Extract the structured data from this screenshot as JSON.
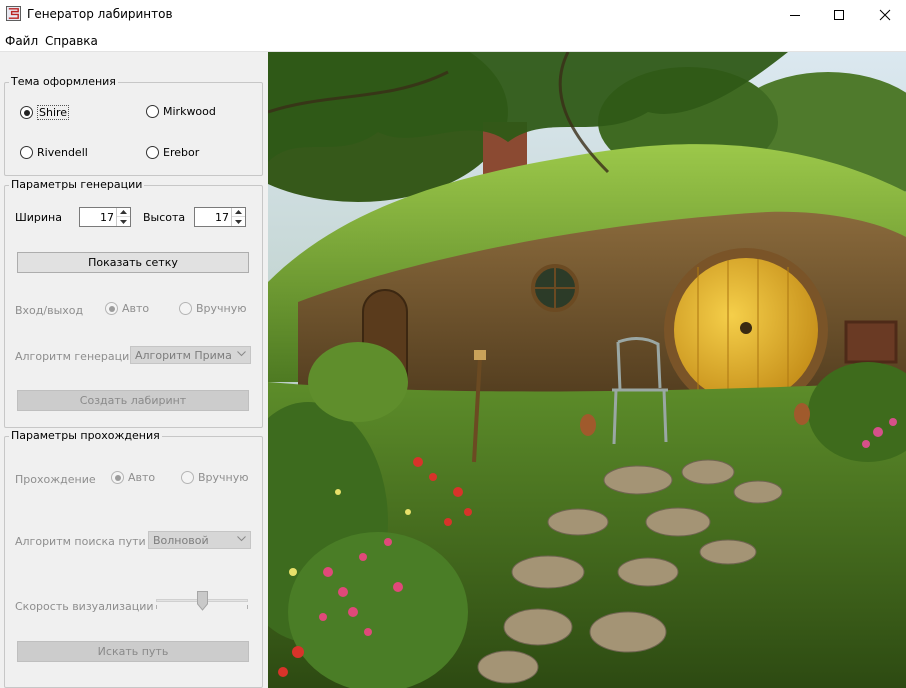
{
  "window": {
    "title": "Генератор лабиринтов",
    "icon": "maze-app-icon"
  },
  "menu": {
    "items": [
      "Файл",
      "Справка"
    ]
  },
  "theme": {
    "legend": "Тема оформления",
    "options": [
      {
        "label": "Shire",
        "selected": true
      },
      {
        "label": "Mirkwood",
        "selected": false
      },
      {
        "label": "Rivendell",
        "selected": false
      },
      {
        "label": "Erebor",
        "selected": false
      }
    ]
  },
  "generation": {
    "legend": "Параметры генерации",
    "width_label": "Ширина",
    "width_value": "17",
    "height_label": "Высота",
    "height_value": "17",
    "show_grid_button": "Показать сетку",
    "entry_label": "Вход/выход",
    "entry_options": [
      {
        "label": "Авто",
        "selected": true
      },
      {
        "label": "Вручную",
        "selected": false
      }
    ],
    "algorithm_label": "Алгоритм генерации",
    "algorithm_value": "Алгоритм Прима",
    "create_button": "Создать лабиринт"
  },
  "solving": {
    "legend": "Параметры прохождения",
    "mode_label": "Прохождение",
    "mode_options": [
      {
        "label": "Авто",
        "selected": true
      },
      {
        "label": "Вручную",
        "selected": false
      }
    ],
    "search_label": "Алгоритм поиска пути",
    "search_value": "Волновой",
    "speed_label": "Скорость визуализации",
    "speed_level": 0.5,
    "find_button": "Искать путь"
  },
  "theme_image": {
    "name": "Shire",
    "description_icon": "hobbit-hole-scene"
  },
  "colors": {
    "door": "#e0b12c",
    "grass": "#7aa83a",
    "sky": "#cfe0ec",
    "path_stone": "#9a8c6e"
  }
}
